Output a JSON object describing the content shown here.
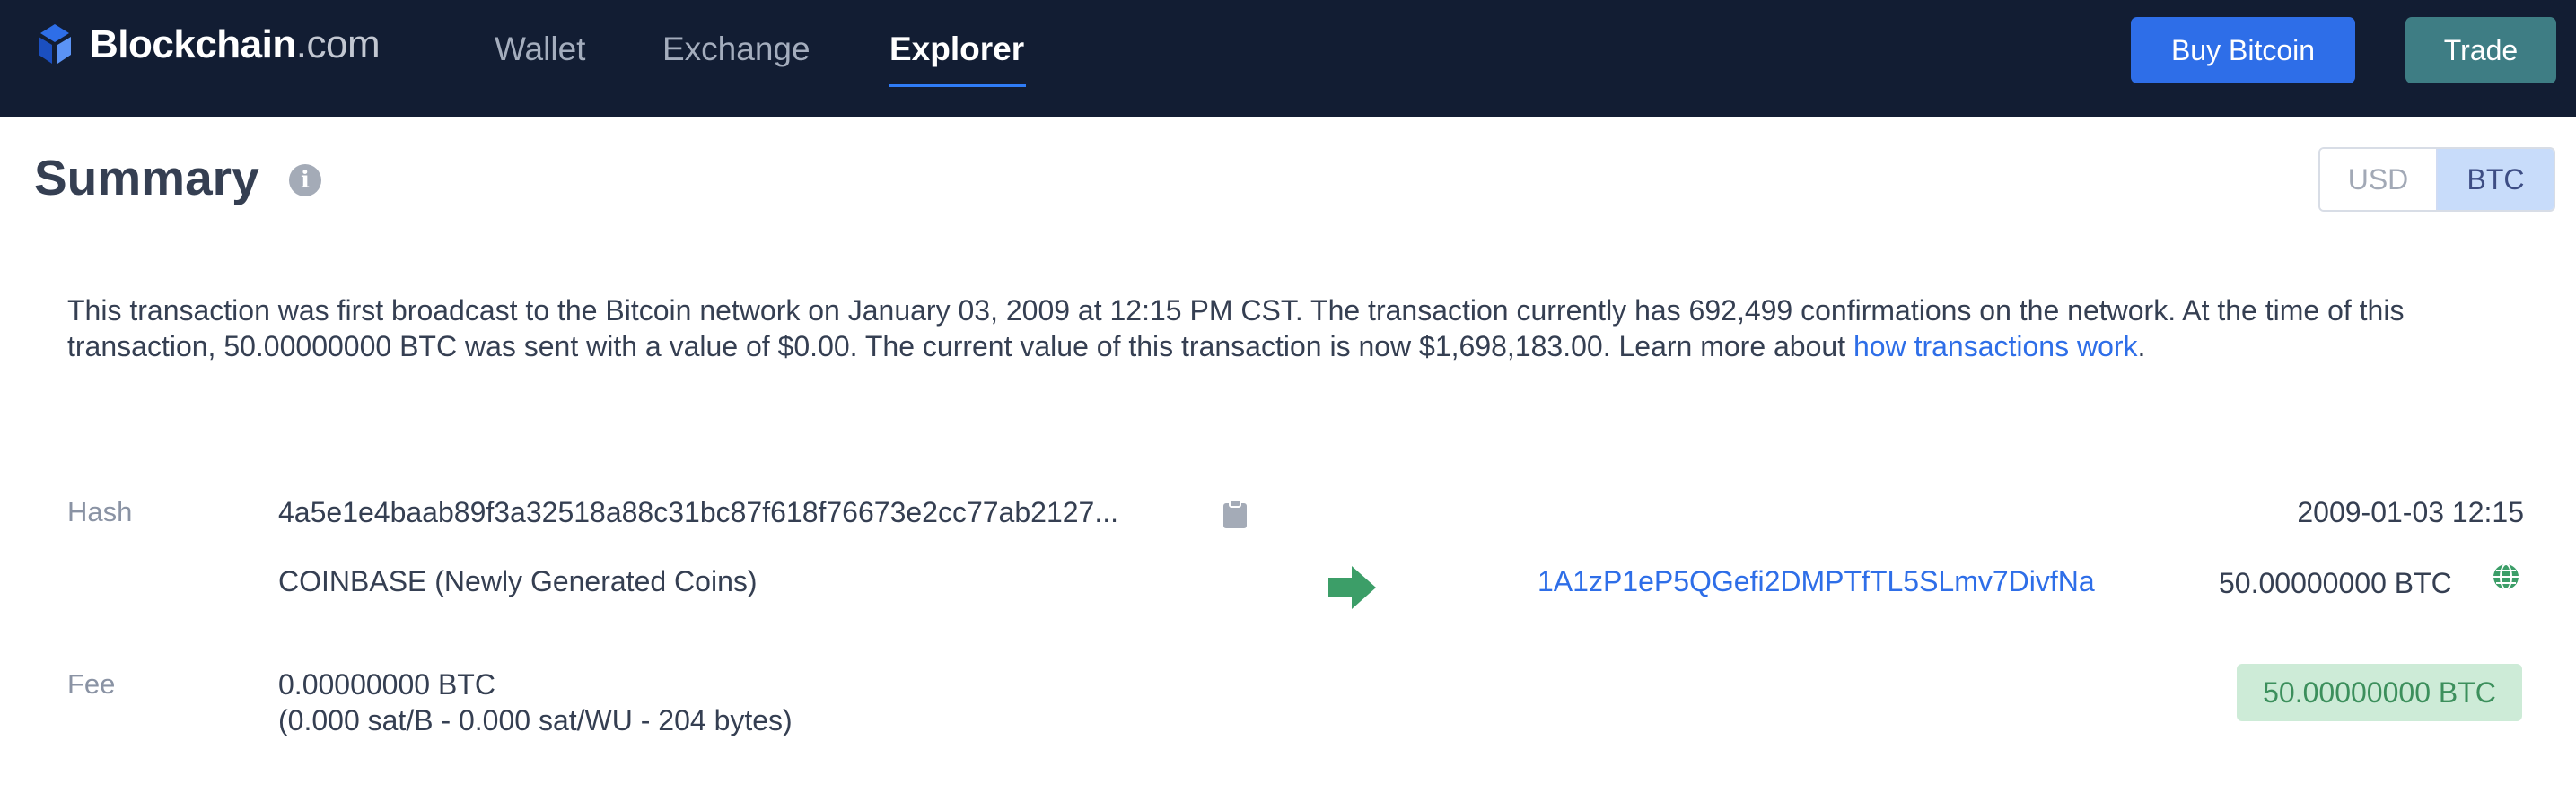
{
  "nav": {
    "brand_bold": "Blockchain",
    "brand_light": ".com",
    "tabs": [
      {
        "label": "Wallet",
        "active": false
      },
      {
        "label": "Exchange",
        "active": false
      },
      {
        "label": "Explorer",
        "active": true
      }
    ],
    "buy_label": "Buy Bitcoin",
    "trade_label": "Trade"
  },
  "summary": {
    "title": "Summary",
    "info_icon": "info-icon",
    "currency_options": [
      "USD",
      "BTC"
    ],
    "selected_currency": "BTC"
  },
  "description": {
    "text": "This transaction was first broadcast to the Bitcoin network on January 03, 2009 at 12:15 PM CST.  The transaction currently has 692,499 confirmations on the network.  At the time of this transaction, 50.00000000 BTC was sent with a value of $0.00. The current value of this transaction is now $1,698,183.00.  Learn more about ",
    "link_text": "how transactions work",
    "end": "."
  },
  "details": {
    "hash_label": "Hash",
    "hash_value": "4a5e1e4baab89f3a32518a88c31bc87f618f76673e2cc77ab2127...",
    "timestamp": "2009-01-03 12:15",
    "input": "COINBASE (Newly Generated Coins)",
    "output_address": "1A1zP1eP5QGefi2DMPTfTL5SLmv7DivfNa",
    "output_amount": "50.00000000 BTC",
    "fee_label": "Fee",
    "fee_value": "0.00000000 BTC",
    "fee_detail": "(0.000 sat/B - 0.000 sat/WU - 204 bytes)",
    "total": "50.00000000 BTC"
  },
  "colors": {
    "nav_bg": "#121d33",
    "accent_blue": "#2e6ee8",
    "trade_teal": "#3e7d84",
    "success_green": "#3c8f5c",
    "success_bg": "#cdebd7"
  },
  "icons": [
    "blockchain-logo-icon",
    "info-icon",
    "clipboard-icon",
    "arrow-right-icon",
    "globe-icon"
  ]
}
